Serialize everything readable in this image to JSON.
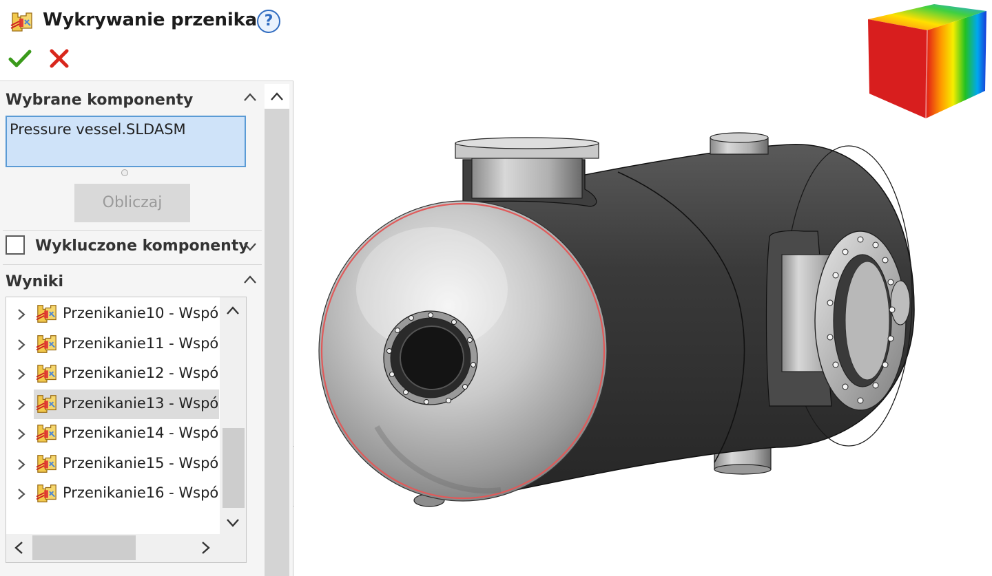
{
  "property_manager": {
    "title": "Wykrywanie przenika...",
    "help_icon": "help-icon",
    "ok_icon": "checkmark-icon",
    "cancel_icon": "close-icon"
  },
  "selected_components": {
    "title": "Wybrane komponenty",
    "value": "Pressure vessel.SLDASM",
    "calculate_label": "Obliczaj"
  },
  "excluded_components": {
    "title": "Wykluczone komponenty",
    "checked": false
  },
  "results": {
    "title": "Wyniki",
    "items": [
      {
        "label": "Przenikanie10 - Wspó",
        "selected": false
      },
      {
        "label": "Przenikanie11 - Wspó",
        "selected": false
      },
      {
        "label": "Przenikanie12 - Wspó",
        "selected": false
      },
      {
        "label": "Przenikanie13 - Wspó",
        "selected": true
      },
      {
        "label": "Przenikanie14 - Wspó",
        "selected": false
      },
      {
        "label": "Przenikanie15 - Wspó",
        "selected": false
      },
      {
        "label": "Przenikanie16 - Wspó",
        "selected": false
      }
    ]
  },
  "colors": {
    "accent": "#5b9bd5",
    "ok_green": "#3a9a1a",
    "cancel_red": "#d8271c",
    "vessel_body": "#3c3c3c",
    "interference_highlight": "#e05a5a"
  }
}
